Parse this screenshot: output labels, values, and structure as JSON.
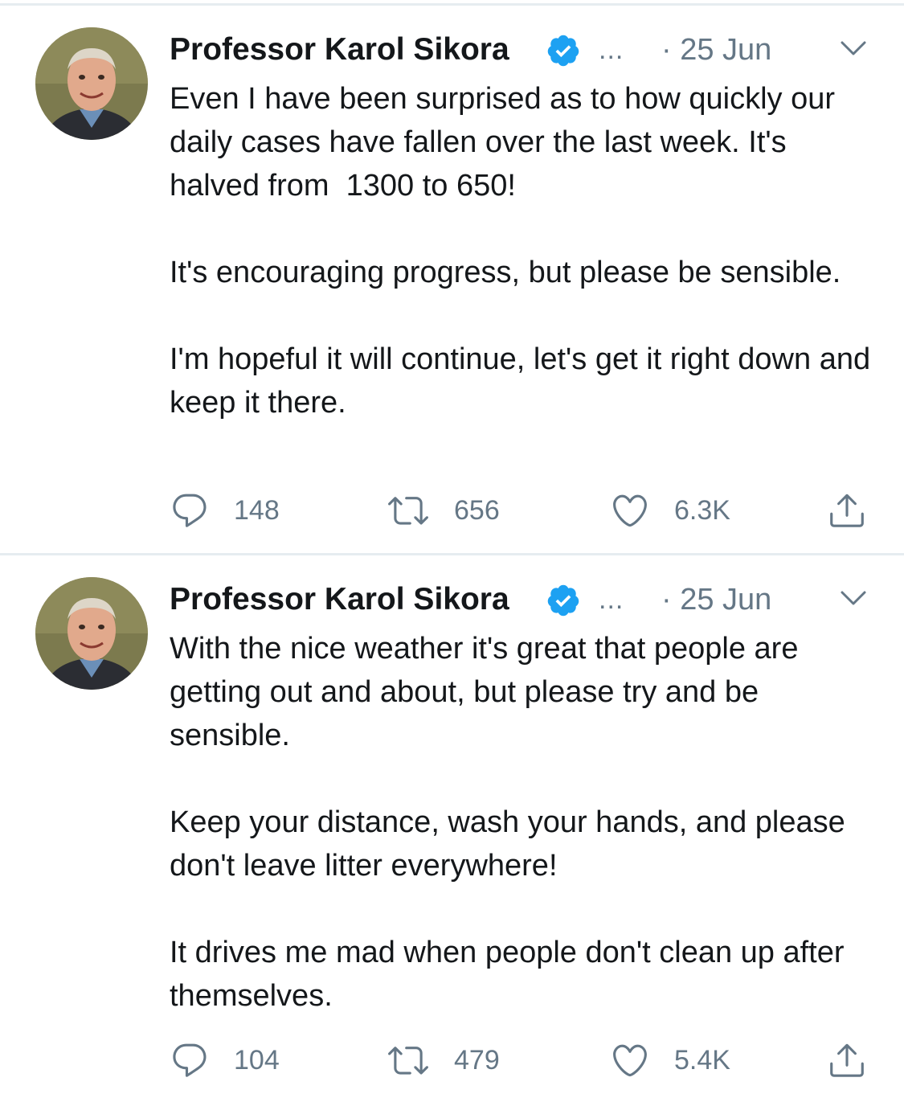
{
  "colors": {
    "text": "#14171a",
    "secondary": "#657786",
    "verified_badge": "#1da1f2",
    "divider": "#e6ecf0"
  },
  "tweets": [
    {
      "author_name": "Professor Karol Sikora",
      "verified": true,
      "handle_truncated": "...",
      "date": "· 25 Jun",
      "avatar_icon": "profile-photo",
      "paragraphs": [
        "Even I have been surprised as to how quickly our daily cases have fallen over the last week. It's halved from  1300 to 650!",
        "It's encouraging progress, but please be sensible.",
        "I'm hopeful it will continue, let's get it right down and keep it there."
      ],
      "replies": "148",
      "retweets": "656",
      "likes": "6.3K"
    },
    {
      "author_name": "Professor Karol Sikora",
      "verified": true,
      "handle_truncated": "...",
      "date": "· 25 Jun",
      "avatar_icon": "profile-photo",
      "paragraphs": [
        "With the nice weather it's great that people are getting out and about, but please try and be sensible.",
        "Keep your distance, wash your hands, and please don't leave litter everywhere!",
        "It drives me mad when people don't clean up after themselves."
      ],
      "replies": "104",
      "retweets": "479",
      "likes": "5.4K"
    }
  ]
}
